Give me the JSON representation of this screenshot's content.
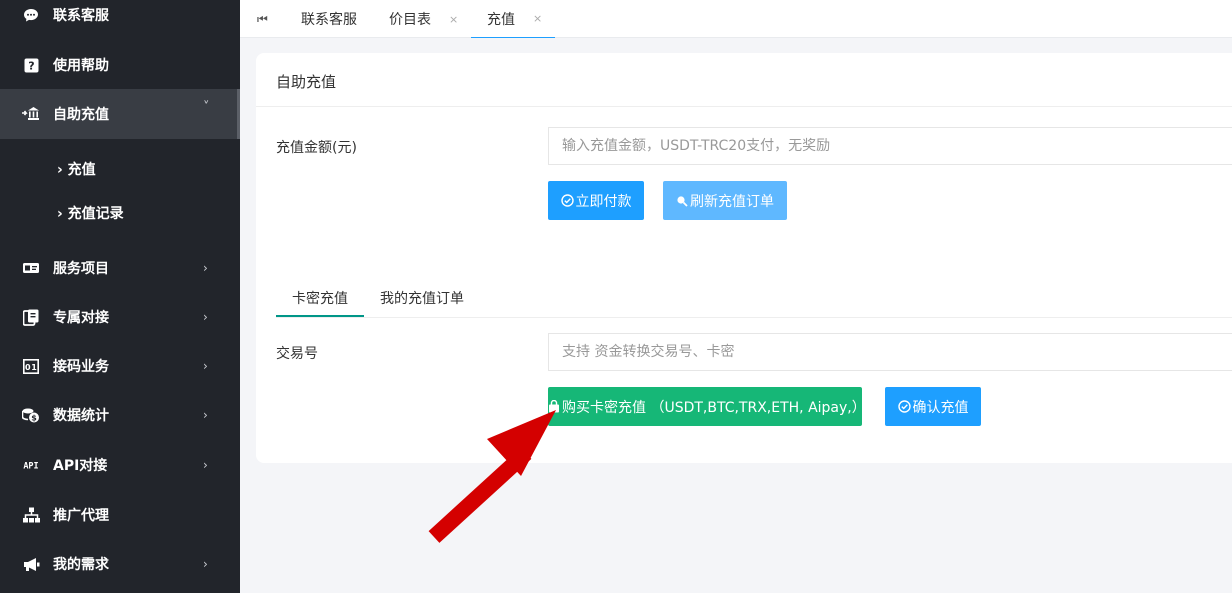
{
  "sidebar": {
    "items": [
      {
        "label": "联系客服",
        "icon": "chat-icon"
      },
      {
        "label": "使用帮助",
        "icon": "help-icon"
      },
      {
        "label": "自助充值",
        "icon": "bank-icon",
        "expanded": true
      },
      {
        "label": "服务项目",
        "icon": "card-icon"
      },
      {
        "label": "专属对接",
        "icon": "connect-icon"
      },
      {
        "label": "接码业务",
        "icon": "code-icon"
      },
      {
        "label": "数据统计",
        "icon": "coins-icon"
      },
      {
        "label": "API对接",
        "icon": "api-icon"
      },
      {
        "label": "推广代理",
        "icon": "sitemap-icon"
      },
      {
        "label": "我的需求",
        "icon": "megaphone-icon"
      }
    ],
    "subitems": [
      {
        "label": "充值"
      },
      {
        "label": "充值记录"
      }
    ],
    "arrow_right": "›",
    "arrow_down": "˅"
  },
  "tabs": {
    "home_icon": "⏮",
    "items": [
      {
        "label": "联系客服"
      },
      {
        "label": "价目表",
        "close": "×"
      },
      {
        "label": "充值",
        "close": "×",
        "active": true
      }
    ]
  },
  "card": {
    "title": "自助充值",
    "amount_label": "充值金额(元)",
    "amount_placeholder": "输入充值金额，USDT-TRC20支付，无奖励",
    "pay_button": "立即付款",
    "refresh_button": "刷新充值订单",
    "subtabs": [
      {
        "label": "卡密充值",
        "active": true
      },
      {
        "label": "我的充值订单"
      }
    ],
    "txn_label": "交易号",
    "txn_placeholder": "支持 资金转换交易号、卡密",
    "buy_card_button": "购买卡密充值 （USDT,BTC,TRX,ETH, Aipay,）",
    "confirm_button": "确认充值"
  },
  "colors": {
    "sidebar_bg": "#22252b",
    "primary_blue": "#1e9fff",
    "light_blue": "#5fb8ff",
    "green": "#16b777",
    "annotation_arrow": "#d40000"
  }
}
